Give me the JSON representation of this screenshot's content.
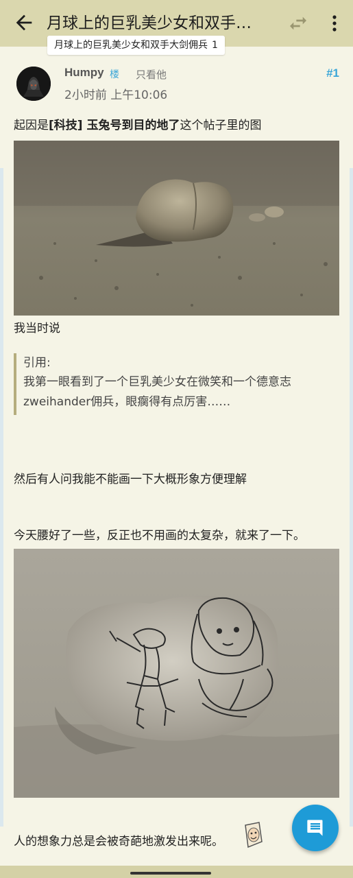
{
  "appbar": {
    "title": "月球上的巨乳美少女和双手…",
    "tooltip_title": "月球上的巨乳美少女和双手大剑佣兵",
    "tooltip_count": "1"
  },
  "post": {
    "author": "Humpy",
    "lou_badge": "楼",
    "only_view": "只看他",
    "floor": "#1",
    "time": "2小时前 上午10:06",
    "line1_prefix": "起因是",
    "line1_bold": "[科技] 玉兔号到目的地了",
    "line1_suffix": "这个帖子里的图",
    "line2": "我当时说",
    "quote_label": "引用:",
    "quote_line1": "我第一眼看到了一个巨乳美少女在微笑和一个德意志",
    "quote_line2": "zweihander佣兵，眼瘸得有点厉害……",
    "line3": "然后有人问我能不能画一下大概形象方便理解",
    "line4": "今天腰好了一些，反正也不用画的太复杂，就来了一下。",
    "line5": "人的想象力总是会被奇葩地激发出来呢。"
  },
  "colors": {
    "appbar": "#dad7ae",
    "background": "#f5f4e6",
    "accent": "#3aa6d8",
    "fab": "#1e9bd7"
  },
  "icons": {
    "back": "arrow-left-icon",
    "swap": "swap-icon",
    "more": "more-vert-icon",
    "fab": "comment-icon"
  }
}
